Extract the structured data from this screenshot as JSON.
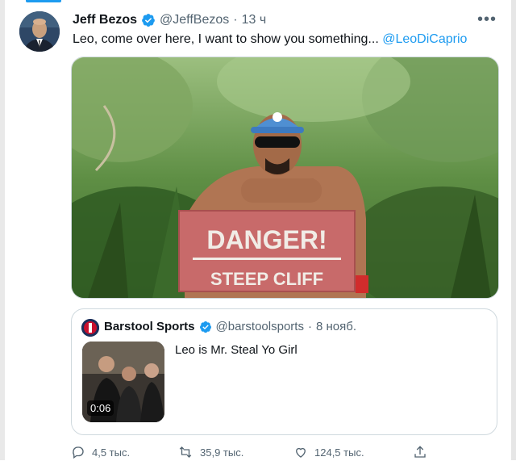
{
  "tweet": {
    "author_name": "Jeff Bezos",
    "author_handle": "@JeffBezos",
    "separator": "·",
    "time": "13 ч",
    "more_label": "•••",
    "text": "Leo, come over here, I want to show you something...",
    "mention": "@LeoDiCaprio",
    "image_sign_line1": "DANGER!",
    "image_sign_line2": "STEEP CLIFF"
  },
  "quote": {
    "author_name": "Barstool Sports",
    "author_handle": "@barstoolsports",
    "separator": "·",
    "time": "8 нояб.",
    "text": "Leo is Mr. Steal Yo Girl",
    "video_duration": "0:06"
  },
  "actions": {
    "replies": "4,5 тыс.",
    "retweets": "35,9 тыс.",
    "likes": "124,5 тыс."
  },
  "colors": {
    "accent": "#1d9bf0",
    "secondary_text": "#536471",
    "border": "#cfd9de"
  },
  "icons": [
    "verified-badge-icon",
    "more-icon",
    "reply-icon",
    "retweet-icon",
    "like-icon",
    "share-icon"
  ]
}
